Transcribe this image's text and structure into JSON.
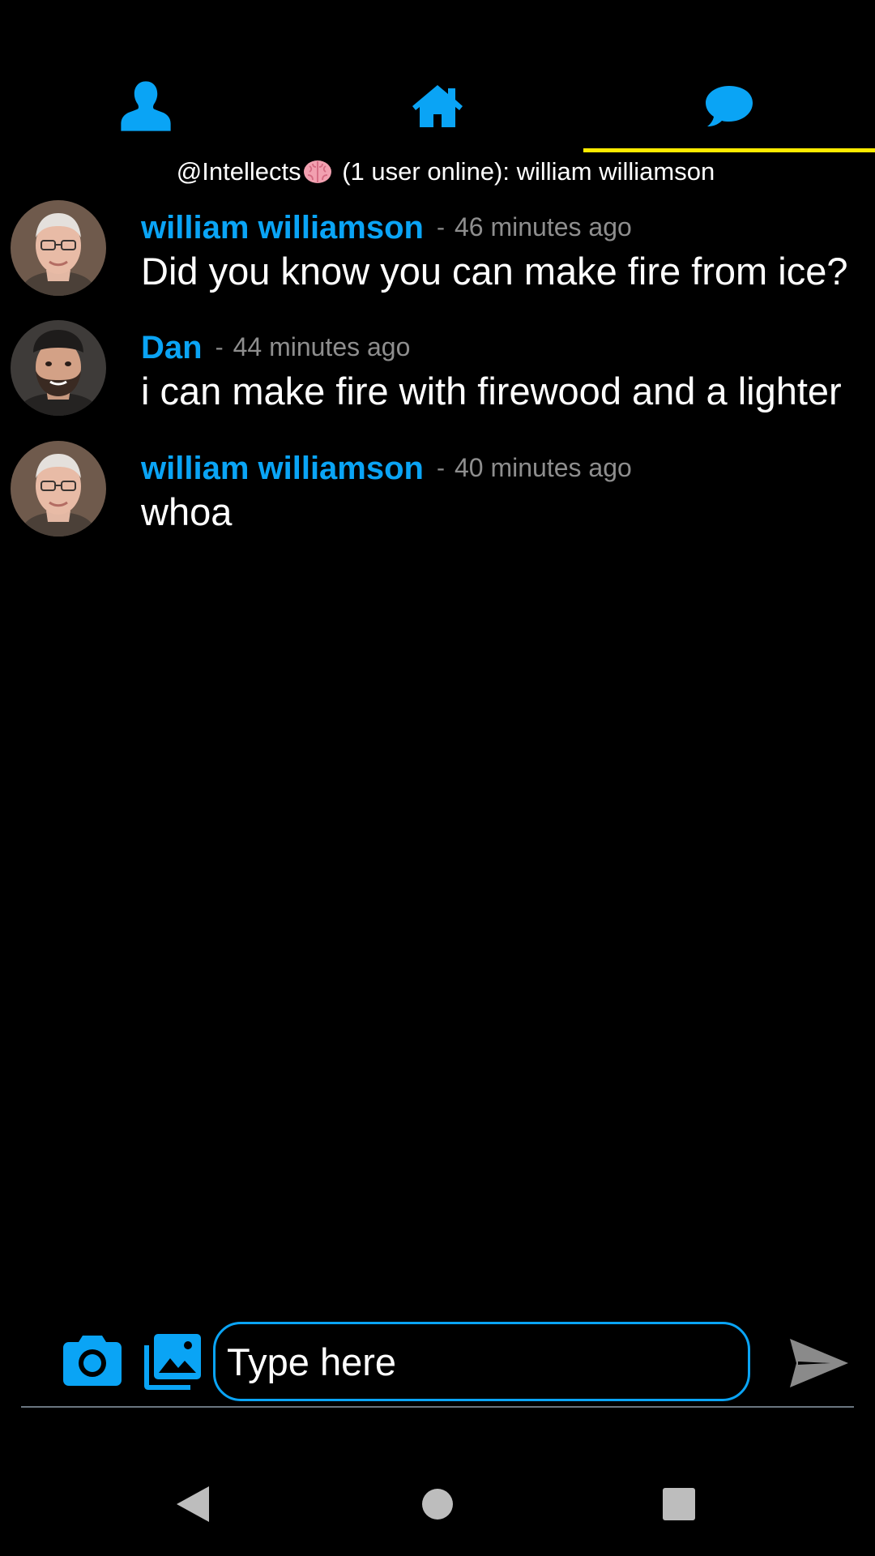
{
  "tabs": [
    {
      "label": "profile",
      "icon": "person-icon"
    },
    {
      "label": "home",
      "icon": "home-icon"
    },
    {
      "label": "chat",
      "icon": "chat-bubble-icon",
      "active": true
    }
  ],
  "colors": {
    "accent": "#0aa4f5",
    "active_tab": "#ffeb00",
    "background": "#000000",
    "muted": "#8e8e8e"
  },
  "room": {
    "name": "@Intellects",
    "emoji": "brain-icon",
    "status": "(1 user online): william williamson"
  },
  "messages": [
    {
      "author": "william williamson",
      "separator": "-",
      "time": "46 minutes ago",
      "text": "Did you know you can make fire from ice?",
      "avatar": "older-man-avatar"
    },
    {
      "author": "Dan",
      "separator": "-",
      "time": "44 minutes ago",
      "text": "i can make fire with firewood and a lighter",
      "avatar": "bearded-man-avatar"
    },
    {
      "author": "william williamson",
      "separator": "-",
      "time": "40 minutes ago",
      "text": "whoa",
      "avatar": "older-man-avatar"
    }
  ],
  "composer": {
    "placeholder": "Type here"
  }
}
